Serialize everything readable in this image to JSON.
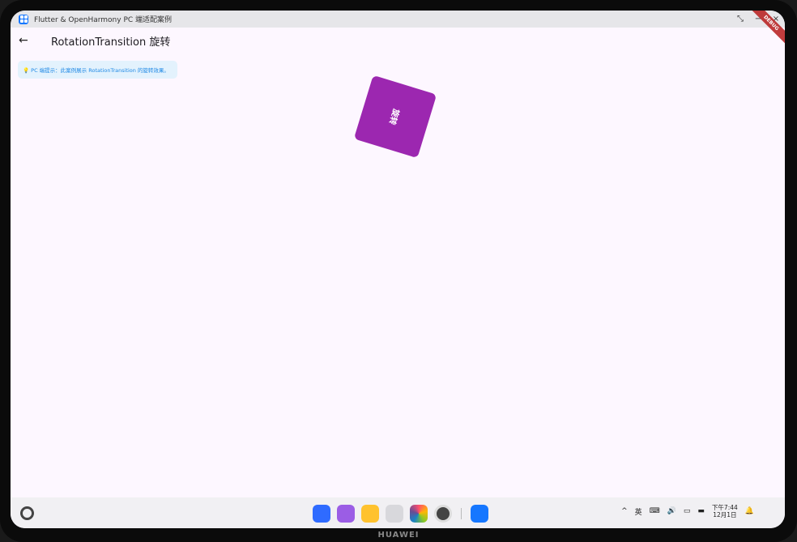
{
  "window": {
    "title": "Flutter & OpenHarmony PC 端适配案例",
    "controls": [
      "⤡",
      "−",
      "×"
    ]
  },
  "appbar": {
    "back_icon": "←",
    "title": "RotationTransition 旋转"
  },
  "tip": {
    "text": "💡 PC 端提示：此案例展示 RotationTransition 的旋转效果。"
  },
  "box": {
    "label": "旋转",
    "color": "#9c27b0",
    "rotation_turns": 0.047
  },
  "debug_banner": "DEBUG",
  "taskbar": {
    "dock": [
      "app-center",
      "multitask",
      "files",
      "trash",
      "gallery",
      "settings",
      "flutter-app"
    ],
    "tray_icons": [
      "^",
      "英",
      "⌨",
      "🔊",
      "▭",
      "▬"
    ],
    "time": "下午7:44",
    "date": "12月1日",
    "bell": "🔔"
  },
  "brand": "HUAWEI"
}
